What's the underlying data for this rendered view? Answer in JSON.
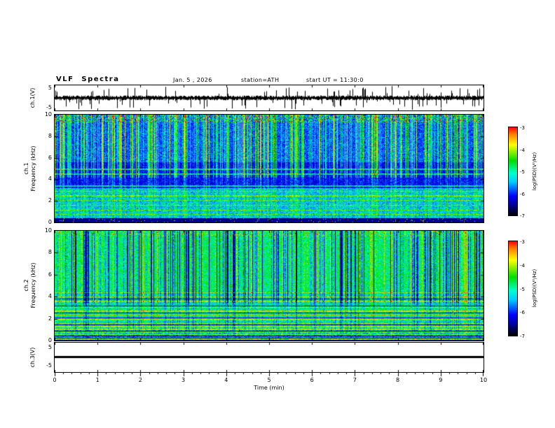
{
  "header": {
    "title": "VLF Spectra",
    "date": "Jan. 5 , 2026",
    "station": "station=ATH",
    "start_ut": "start UT = 11:30:0"
  },
  "panels": {
    "ch1_wave": {
      "label": "ch.1(V)",
      "ymax": "5",
      "ymin": "-5"
    },
    "ch1_spec": {
      "label_top": "ch.1",
      "label_bottom": "Frequency (kHz)",
      "yticks": [
        "10",
        "8",
        "6",
        "4",
        "2",
        "0"
      ]
    },
    "ch2_spec": {
      "label_top": "ch.2",
      "label_bottom": "Frequency (kHz)",
      "yticks": [
        "10",
        "8",
        "6",
        "4",
        "2",
        "0"
      ]
    },
    "ch3_wave": {
      "label": "ch.3(V)",
      "ymax": "5",
      "ymin": "-5"
    }
  },
  "xaxis": {
    "ticks": [
      "0",
      "1",
      "2",
      "3",
      "4",
      "5",
      "6",
      "7",
      "8",
      "9",
      "10"
    ],
    "label": "Time (min)"
  },
  "colorbar": {
    "ticks": [
      "-3",
      "-4",
      "-5",
      "-6",
      "-7"
    ],
    "label": "log(PSD)(V²/Hz)",
    "colors": [
      "#ff0000 0%",
      "#ff8000 8%",
      "#ffff00 20%",
      "#00dd00 38%",
      "#00ffcc 52%",
      "#00ccff 62%",
      "#0000ff 78%",
      "#000099 88%",
      "#000000 100%"
    ]
  },
  "chart_data": [
    {
      "type": "line",
      "panel": "ch.1(V)",
      "xlabel": "Time (min)",
      "xlim": [
        0,
        10
      ],
      "ylim": [
        -5,
        5
      ],
      "yticks": [
        5,
        -5
      ],
      "description": "Dense noisy voltage waveform centered on 0 V with frequent impulsive spikes reaching roughly ±4 V across the full 10 minutes"
    },
    {
      "type": "heatmap",
      "panel": "ch.1 spectrogram",
      "xlabel": "Time (min)",
      "xlim": [
        0,
        10
      ],
      "ylabel": "Frequency (kHz)",
      "ylim": [
        0,
        10
      ],
      "yticks": [
        10,
        8,
        6,
        4,
        2,
        0
      ],
      "zlabel": "log(PSD)(V²/Hz)",
      "zlim": [
        -7,
        -3
      ],
      "description": "Blue background with dense broadband vertical impulses (green/yellow/red) strongest above 4 kHz, a darker blue band near 3-5.5 kHz, persistent narrow horizontal emission lines between about 1 and 5 kHz, and a near-black band below 0.5 kHz with sparse bright speckles"
    },
    {
      "type": "heatmap",
      "panel": "ch.2 spectrogram",
      "xlabel": "Time (min)",
      "xlim": [
        0,
        10
      ],
      "ylabel": "Frequency (kHz)",
      "ylim": [
        0,
        10
      ],
      "yticks": [
        10,
        8,
        6,
        4,
        2,
        0
      ],
      "zlabel": "log(PSD)(V²/Hz)",
      "zlim": [
        -7,
        -3
      ],
      "description": "Green/cyan background with strong dark-blue and black vertical stripes above ~4 kHz, layered horizontal red/yellow and dark emission lines below 4 kHz, and a black band with a red emission line near 0.2 kHz"
    },
    {
      "type": "line",
      "panel": "ch.3(V)",
      "xlabel": "Time (min)",
      "xlim": [
        0,
        10
      ],
      "ylim": [
        -5,
        5
      ],
      "yticks": [
        5,
        -5
      ],
      "values_constant": 0,
      "description": "Flat black line at 0 V for the entire record (channel inactive)"
    }
  ]
}
